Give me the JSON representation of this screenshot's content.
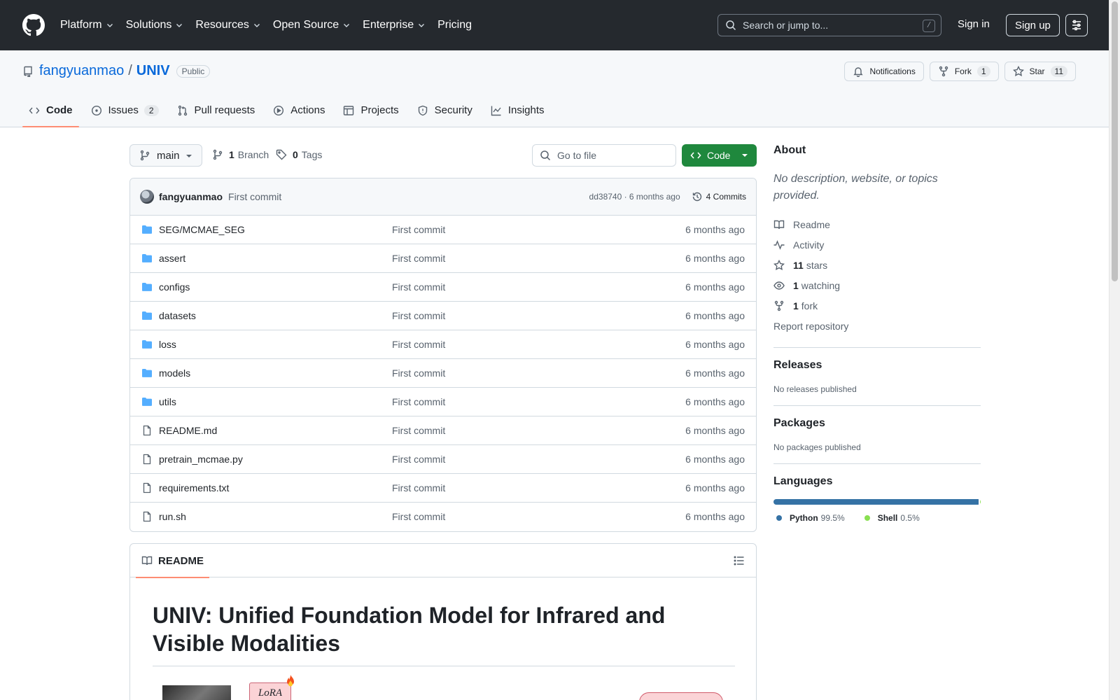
{
  "topnav": {
    "items": [
      {
        "label": "Platform",
        "has_menu": true
      },
      {
        "label": "Solutions",
        "has_menu": true
      },
      {
        "label": "Resources",
        "has_menu": true
      },
      {
        "label": "Open Source",
        "has_menu": true
      },
      {
        "label": "Enterprise",
        "has_menu": true
      },
      {
        "label": "Pricing",
        "has_menu": false
      }
    ],
    "search_placeholder": "Search or jump to...",
    "search_shortcut": "/",
    "sign_in": "Sign in",
    "sign_up": "Sign up"
  },
  "repo": {
    "owner": "fangyuanmao",
    "separator": "/",
    "name": "UNIV",
    "visibility": "Public",
    "notifications_label": "Notifications",
    "fork_label": "Fork",
    "fork_count": "1",
    "star_label": "Star",
    "star_count": "11"
  },
  "tabs": [
    {
      "label": "Code",
      "icon": "code-icon",
      "active": true,
      "count": ""
    },
    {
      "label": "Issues",
      "icon": "issue-icon",
      "active": false,
      "count": "2"
    },
    {
      "label": "Pull requests",
      "icon": "pull-request-icon",
      "active": false,
      "count": ""
    },
    {
      "label": "Actions",
      "icon": "play-icon",
      "active": false,
      "count": ""
    },
    {
      "label": "Projects",
      "icon": "table-icon",
      "active": false,
      "count": ""
    },
    {
      "label": "Security",
      "icon": "shield-icon",
      "active": false,
      "count": ""
    },
    {
      "label": "Insights",
      "icon": "graph-icon",
      "active": false,
      "count": ""
    }
  ],
  "branchbar": {
    "branch": "main",
    "branch_count": "1",
    "branch_label": "Branch",
    "tag_count": "0",
    "tag_label": "Tags",
    "goto_placeholder": "Go to file",
    "code_button": "Code"
  },
  "commit": {
    "author": "fangyuanmao",
    "message": "First commit",
    "sha_time": "dd38740 · 6 months ago",
    "commits_label": "4 Commits"
  },
  "files": [
    {
      "name": "SEG/MCMAE_SEG",
      "type": "folder",
      "message": "First commit",
      "time": "6 months ago"
    },
    {
      "name": "assert",
      "type": "folder",
      "message": "First commit",
      "time": "6 months ago"
    },
    {
      "name": "configs",
      "type": "folder",
      "message": "First commit",
      "time": "6 months ago"
    },
    {
      "name": "datasets",
      "type": "folder",
      "message": "First commit",
      "time": "6 months ago"
    },
    {
      "name": "loss",
      "type": "folder",
      "message": "First commit",
      "time": "6 months ago"
    },
    {
      "name": "models",
      "type": "folder",
      "message": "First commit",
      "time": "6 months ago"
    },
    {
      "name": "utils",
      "type": "folder",
      "message": "First commit",
      "time": "6 months ago"
    },
    {
      "name": "README.md",
      "type": "file",
      "message": "First commit",
      "time": "6 months ago"
    },
    {
      "name": "pretrain_mcmae.py",
      "type": "file",
      "message": "First commit",
      "time": "6 months ago"
    },
    {
      "name": "requirements.txt",
      "type": "file",
      "message": "First commit",
      "time": "6 months ago"
    },
    {
      "name": "run.sh",
      "type": "file",
      "message": "First commit",
      "time": "6 months ago"
    }
  ],
  "readme": {
    "tab_label": "README",
    "title": "UNIV: Unified Foundation Model for Infrared and Visible Modalities",
    "figure_label": "LoRA"
  },
  "sidebar": {
    "about_title": "About",
    "about_desc": "No description, website, or topics provided.",
    "links": [
      {
        "icon": "book-icon",
        "bold": "",
        "text": "Readme"
      },
      {
        "icon": "pulse-icon",
        "bold": "",
        "text": "Activity"
      },
      {
        "icon": "star-icon",
        "bold": "11",
        "text": "stars"
      },
      {
        "icon": "eye-icon",
        "bold": "1",
        "text": "watching"
      },
      {
        "icon": "fork-icon",
        "bold": "1",
        "text": "fork"
      }
    ],
    "report": "Report repository",
    "releases_title": "Releases",
    "releases_desc": "No releases published",
    "packages_title": "Packages",
    "packages_desc": "No packages published",
    "languages_title": "Languages",
    "languages": [
      {
        "name": "Python",
        "percent": 99.5,
        "label": "99.5%",
        "color": "#3572A5"
      },
      {
        "name": "Shell",
        "percent": 0.5,
        "label": "0.5%",
        "color": "#89e051"
      }
    ]
  },
  "colors": {
    "header_bg": "#25292e",
    "link": "#0969da",
    "primary_button": "#1f883d",
    "active_tab_underline": "#fd8c73",
    "folder": "#54aeff"
  }
}
